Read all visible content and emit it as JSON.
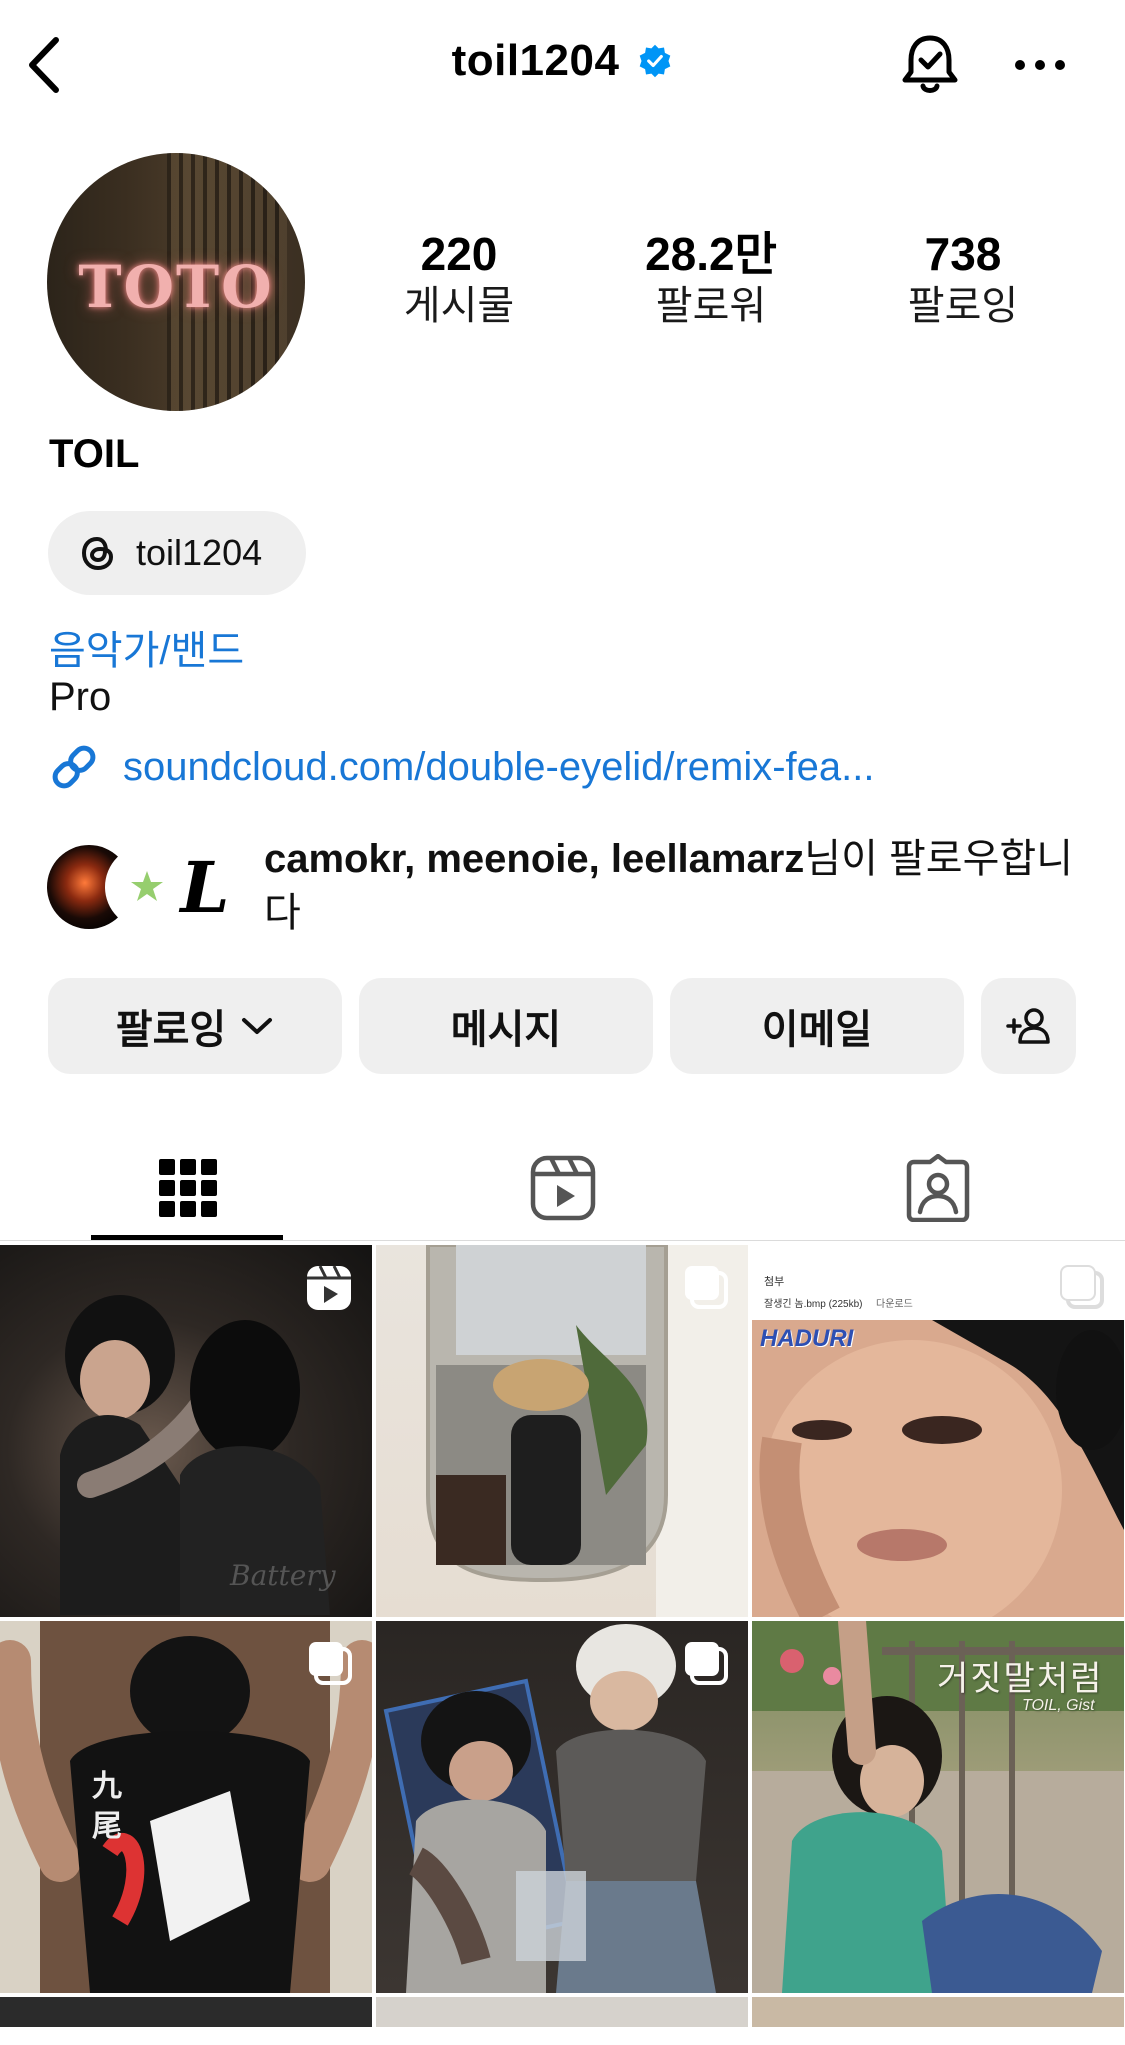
{
  "header": {
    "username": "toil1204",
    "verified": true
  },
  "profile": {
    "avatar_text": "TOTO",
    "stats": [
      {
        "value": "220",
        "label": "게시물"
      },
      {
        "value": "28.2만",
        "label": "팔로워"
      },
      {
        "value": "738",
        "label": "팔로잉"
      }
    ],
    "display_name": "TOIL",
    "threads_handle": "toil1204",
    "category": "음악가/밴드",
    "bio": "Pro",
    "link": "soundcloud.com/double-eyelid/remix-fea...",
    "followed_by_names": "camokr, meenoie, leellamarz",
    "followed_by_suffix": "님이 팔로우합니다",
    "mutual_avatar_letter": "L"
  },
  "actions": {
    "following_label": "팔로잉",
    "message_label": "메시지",
    "email_label": "이메일"
  },
  "tabs": [
    {
      "name": "posts-grid",
      "icon": "grid-icon",
      "active": true
    },
    {
      "name": "reels",
      "icon": "reels-icon",
      "active": false
    },
    {
      "name": "tagged",
      "icon": "tagged-icon",
      "active": false
    }
  ],
  "posts": {
    "cell3_header_label": "첨부",
    "cell3_file_label": "잘생긴 놈.bmp (225kb)",
    "cell3_download_label": "다운로드",
    "cell3_caption": "HADURI",
    "cell6_title": "거짓말처럼",
    "cell6_subtitle": "TOIL, Gist"
  },
  "colors": {
    "link_blue": "#1877d6",
    "verified_blue": "#0095f6",
    "button_bg": "#efefef"
  }
}
